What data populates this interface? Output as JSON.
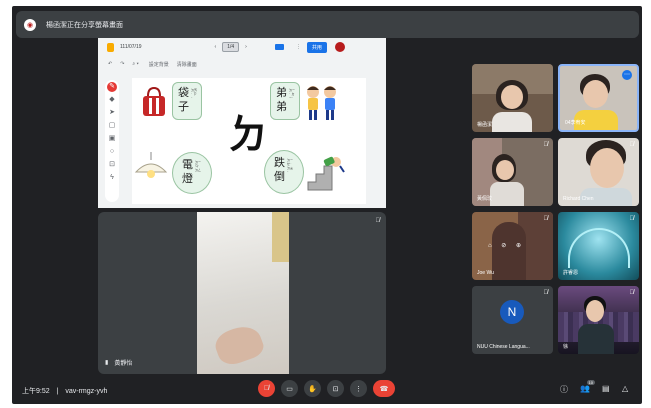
{
  "banner": {
    "icon": "presenter-icon",
    "text": "楊函潔正在分享螢幕畫面"
  },
  "whiteboard": {
    "date": "111/07/19",
    "page": "1/4",
    "zoom_icon": "zoom-icon",
    "menu_items": [
      "設定背景",
      "清除畫面"
    ],
    "share_label": "共用",
    "cards": [
      {
        "chars": "袋\n子",
        "zhuyin": "ㄉㄞˋ ㄗˇ"
      },
      {
        "chars": "弟\n弟",
        "zhuyin": "ㄉㄧˋ ㄉㄧˋ"
      },
      {
        "chars": "電\n燈",
        "zhuyin": "ㄉㄧㄢˋ ㄉㄥ"
      },
      {
        "chars": "跌\n倒",
        "zhuyin": "ㄉㄧㄝˊ ㄉㄠˇ"
      }
    ],
    "big_char": "ㄉ"
  },
  "presenter": {
    "name": "黃靜怡",
    "mic": "mic-off"
  },
  "participants": [
    {
      "name": "楊函潔",
      "mic": "none",
      "bg": "#6d5a4a"
    },
    {
      "name": "04李宥安",
      "mic": "menu",
      "bg": "#c9c3bb"
    },
    {
      "name": "黃佩玟",
      "mic": "mic-off",
      "bg": "#7b6d62"
    },
    {
      "name": "Richard Chen",
      "mic": "mic-off",
      "bg": "#dedad4"
    },
    {
      "name": "Joe Wu",
      "mic": "mic-off",
      "bg": "#8a6448"
    },
    {
      "name": "許睿恩",
      "mic": "mic-off",
      "bg": "#2b8a9e"
    },
    {
      "name": "NUU Chinese Langua...",
      "mic": "mic-off",
      "avatar_letter": "N",
      "bg": "#3c4043"
    },
    {
      "name": "徐",
      "mic": "mic-off",
      "bg": "#3b3046"
    }
  ],
  "bottom_bar": {
    "time": "上午9:52",
    "separator": "|",
    "meeting_code": "vav-rmgz-yvh",
    "controls": [
      "mic-off",
      "camera",
      "raise-hand",
      "present",
      "more",
      "hang-up"
    ],
    "people_count": "10",
    "right_icons": [
      "info-icon",
      "people-icon",
      "chat-icon",
      "activities-icon"
    ]
  }
}
